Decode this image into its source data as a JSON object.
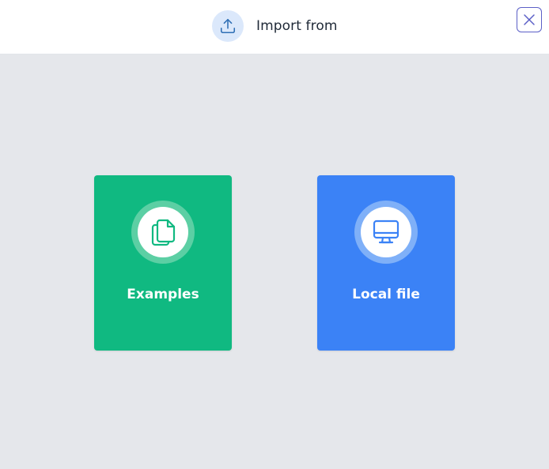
{
  "header": {
    "title": "Import from",
    "icon": "upload-icon",
    "close_icon": "close-icon"
  },
  "options": [
    {
      "label": "Examples",
      "icon": "documents-icon",
      "color": "#10b981"
    },
    {
      "label": "Local file",
      "icon": "monitor-icon",
      "color": "#3b82f6"
    }
  ],
  "colors": {
    "background": "#e5e7eb",
    "header_background": "#ffffff",
    "accent": "#5b5fc7"
  }
}
